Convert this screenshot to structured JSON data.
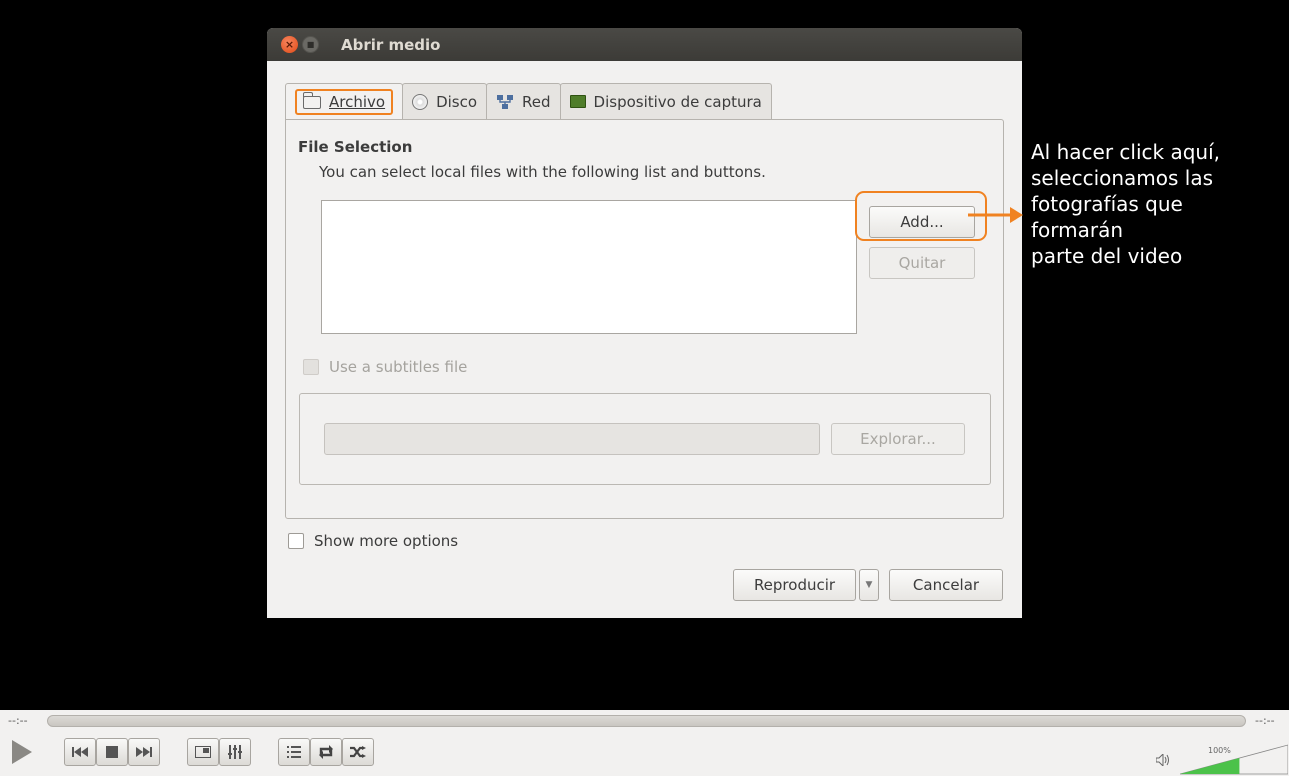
{
  "dialog": {
    "title": "Abrir medio",
    "tabs": [
      {
        "label": "Archivo",
        "icon": "folder-icon"
      },
      {
        "label": "Disco",
        "icon": "disc-icon"
      },
      {
        "label": "Red",
        "icon": "network-icon"
      },
      {
        "label": "Dispositivo de captura",
        "icon": "capture-card-icon"
      }
    ],
    "file_selection": {
      "title": "File Selection",
      "description": "You can select local files with the following list and buttons.",
      "add_label": "Add...",
      "remove_label": "Quitar"
    },
    "subtitles": {
      "checkbox_label": "Use a subtitles file",
      "browse_label": "Explorar...",
      "input_value": ""
    },
    "more_options_label": "Show more options",
    "play_label": "Reproducir",
    "cancel_label": "Cancelar"
  },
  "annotation": {
    "lines": [
      "Al hacer click aquí,",
      "seleccionamos las",
      "fotografías que",
      "formarán",
      "parte del video"
    ],
    "accent_color": "#f08221"
  },
  "player": {
    "time_elapsed": "--:--",
    "time_total": "--:--",
    "volume_label": "100%",
    "volume_fraction": 0.55,
    "controls": [
      "play-icon",
      "previous-icon",
      "stop-icon",
      "next-icon",
      "fullscreen-icon",
      "equalizer-icon",
      "playlist-icon",
      "loop-icon",
      "shuffle-icon",
      "volume-icon"
    ]
  }
}
